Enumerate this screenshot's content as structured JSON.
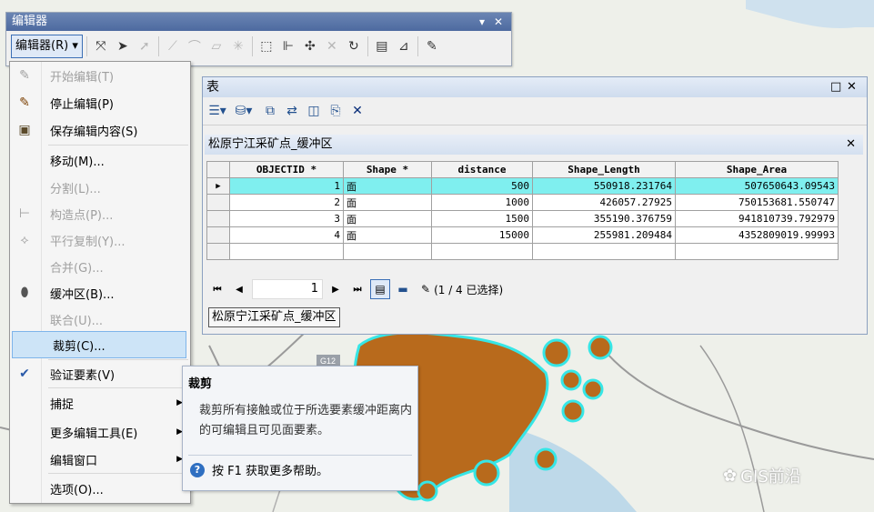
{
  "colors": {
    "buffer_fill": "#b86a1c",
    "buffer_outline": "#36e6e6",
    "selected_row": "#7fefef",
    "title_bar": "#5a77aa"
  },
  "editor_toolbar": {
    "title": "编辑器",
    "menu_button": "编辑器(R)",
    "pin": "▾",
    "close": "✕"
  },
  "editor_menu": {
    "items": [
      {
        "label": "开始编辑(T)",
        "icon": "pencil-icon",
        "glyph": "✎",
        "enabled": false
      },
      {
        "label": "停止编辑(P)",
        "icon": "stop-edit-icon",
        "glyph": "✎",
        "enabled": true
      },
      {
        "label": "保存编辑内容(S)",
        "icon": "save-icon",
        "glyph": "▣",
        "enabled": true
      },
      {
        "label": "移动(M)...",
        "icon": "",
        "glyph": "",
        "enabled": true
      },
      {
        "label": "分割(L)...",
        "icon": "",
        "glyph": "",
        "enabled": false
      },
      {
        "label": "构造点(P)...",
        "icon": "construct-points-icon",
        "glyph": "⊢",
        "enabled": false
      },
      {
        "label": "平行复制(Y)...",
        "icon": "copy-parallel-icon",
        "glyph": "⟡",
        "enabled": false
      },
      {
        "label": "合并(G)...",
        "icon": "",
        "glyph": "",
        "enabled": false
      },
      {
        "label": "缓冲区(B)...",
        "icon": "buffer-icon",
        "glyph": "⬮",
        "enabled": true
      },
      {
        "label": "联合(U)...",
        "icon": "",
        "glyph": "",
        "enabled": false
      },
      {
        "label": "裁剪(C)...",
        "icon": "",
        "glyph": "",
        "enabled": true,
        "highlighted": true
      },
      {
        "label": "验证要素(V)",
        "icon": "validate-icon",
        "glyph": "✔",
        "enabled": true
      },
      {
        "label": "捕捉",
        "icon": "",
        "glyph": "",
        "enabled": true,
        "submenu": true
      },
      {
        "label": "更多编辑工具(E)",
        "icon": "",
        "glyph": "",
        "enabled": true,
        "submenu": true
      },
      {
        "label": "编辑窗口",
        "icon": "",
        "glyph": "",
        "enabled": true,
        "submenu": true
      },
      {
        "label": "选项(O)...",
        "icon": "",
        "glyph": "",
        "enabled": true
      }
    ]
  },
  "table_window": {
    "title": "表",
    "restore": "□",
    "close": "✕",
    "layer_tab": "松原宁江采矿点_缓冲区",
    "columns": [
      "OBJECTID *",
      "Shape *",
      "distance",
      "Shape_Length",
      "Shape_Area"
    ],
    "rows": [
      [
        "1",
        "面",
        "500",
        "550918.231764",
        "507650643.09543"
      ],
      [
        "2",
        "面",
        "1000",
        "426057.27925",
        "750153681.550747"
      ],
      [
        "3",
        "面",
        "1500",
        "355190.376759",
        "941810739.792979"
      ],
      [
        "4",
        "面",
        "15000",
        "255981.209484",
        "4352809019.99993"
      ]
    ],
    "current_record": "1",
    "selection_status": "(1 / 4 已选择)",
    "bottom_tab": "松原宁江采矿点_缓冲区"
  },
  "tooltip": {
    "title": "裁剪",
    "body": "裁剪所有接触或位于所选要素缓冲距离内的可编辑且可见面要素。",
    "help": "按 F1 获取更多帮助。"
  },
  "map": {
    "road_label": "G12"
  },
  "watermark": "GIS前沿"
}
